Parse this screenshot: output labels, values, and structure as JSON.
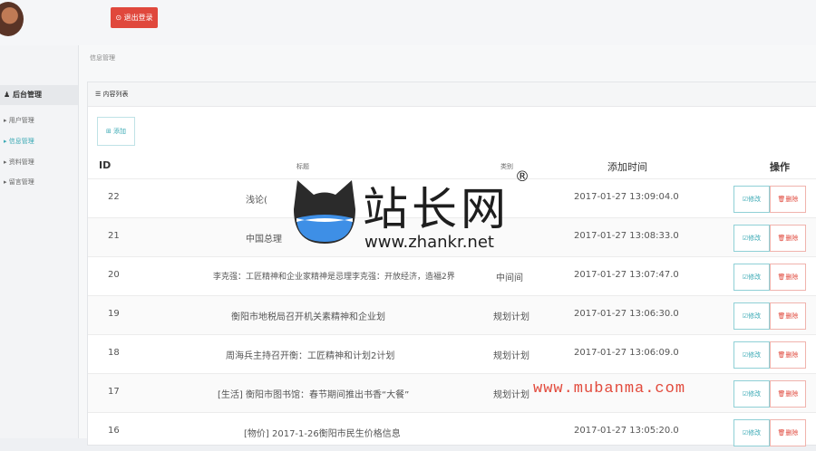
{
  "header": {
    "logout_label": "⊙ 退出登录"
  },
  "sidebar": {
    "title": "后台管理",
    "items": [
      {
        "label": "用户管理"
      },
      {
        "label": "信息管理",
        "active": true
      },
      {
        "label": "资料管理"
      },
      {
        "label": "留言管理"
      }
    ]
  },
  "breadcrumb": "信息管理",
  "panel": {
    "title": "☰ 内容列表",
    "add_label": "⊞ 添加",
    "columns": {
      "id": "ID",
      "title": "标题",
      "category": "类别",
      "time": "添加时间",
      "action": "操作"
    },
    "edit_label": "☑修改",
    "delete_label": "🗑删除",
    "rows": [
      {
        "id": "22",
        "title": "浅论(",
        "category": "",
        "time": "2017-01-27 13:09:04.0"
      },
      {
        "id": "21",
        "title": "中国总理",
        "category": "",
        "time": "2017-01-27 13:08:33.0"
      },
      {
        "id": "20",
        "title": "李克强：工匠精神和企业家精神是忌理李克强：开放经济，造福2界",
        "category": "中间间",
        "time": "2017-01-27 13:07:47.0"
      },
      {
        "id": "19",
        "title": "衡阳市地税局召开机关素精神和企业划",
        "category": "规划计划",
        "time": "2017-01-27 13:06:30.0"
      },
      {
        "id": "18",
        "title": "周海兵主持召开衡：工匠精神和计划2计划",
        "category": "规划计划",
        "time": "2017-01-27 13:06:09.0"
      },
      {
        "id": "17",
        "title": "[生活] 衡阳市图书馆：春节期间推出书香“大餐”",
        "category": "规划计划",
        "time": ""
      },
      {
        "id": "16",
        "title": "[物价] 2017-1-26衡阳市民生价格信息",
        "category": "",
        "time": "2017-01-27 13:05:20.0"
      }
    ]
  },
  "watermark": {
    "brand": "站长网",
    "url": "www.zhankr.net",
    "reg": "®",
    "mubanma": "www.mubanma.com",
    "colors": {
      "cat": "#2b2b2b",
      "water": "#3e8fe6"
    }
  }
}
